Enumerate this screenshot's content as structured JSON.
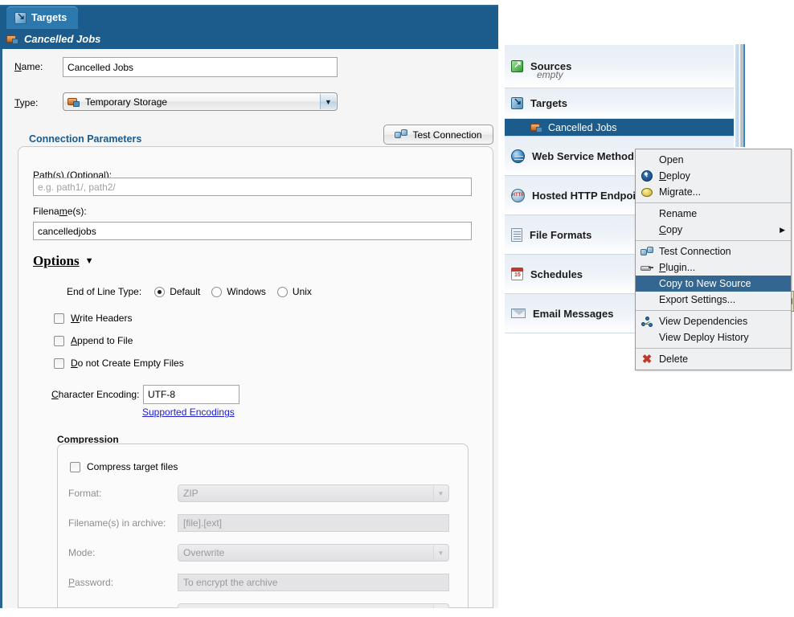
{
  "editor": {
    "tab": {
      "label": "Targets",
      "icon": "targets-icon"
    },
    "subtitle": {
      "label": "Cancelled Jobs",
      "icon": "temporary-storage-icon"
    },
    "name_field": {
      "label": "Name:",
      "value": "Cancelled Jobs"
    },
    "type_field": {
      "label": "Type:",
      "value": "Temporary Storage"
    },
    "connection_parameters": {
      "heading": "Connection Parameters",
      "test_connection_button": "Test Connection",
      "paths": {
        "label": "Path(s) (Optional):",
        "value": "",
        "placeholder": "e.g. path1/, path2/"
      },
      "filenames": {
        "label": "Filename(s):",
        "value": "cancelledjobs"
      }
    },
    "options": {
      "heading": "Options",
      "end_of_line": {
        "label": "End of Line Type:",
        "choices": [
          "Default",
          "Windows",
          "Unix"
        ],
        "selected": "Default"
      },
      "checkboxes": [
        {
          "label": "Write Headers",
          "checked": false
        },
        {
          "label": "Append to File",
          "checked": false
        },
        {
          "label": "Do not Create Empty Files",
          "checked": false
        }
      ],
      "character_encoding": {
        "label": "Character Encoding:",
        "value": "UTF-8"
      },
      "supported_encodings_link": "Supported Encodings"
    },
    "compression": {
      "heading": "Compression",
      "compress_checkbox": {
        "label": "Compress target files",
        "checked": false
      },
      "format": {
        "label": "Format:",
        "value": "ZIP"
      },
      "archive_filenames": {
        "label": "Filename(s) in archive:",
        "value": "[file].[ext]"
      },
      "mode": {
        "label": "Mode:",
        "value": "Overwrite"
      },
      "password": {
        "label": "Password:",
        "placeholder": "To encrypt the archive"
      }
    }
  },
  "tree": {
    "items": [
      {
        "label": "Sources",
        "icon": "sources-icon",
        "sub": "empty"
      },
      {
        "label": "Targets",
        "icon": "targets-icon",
        "child": {
          "label": "Cancelled Jobs",
          "icon": "temporary-storage-icon",
          "selected": true
        }
      },
      {
        "label": "Web Service Method",
        "icon": "web-service-icon"
      },
      {
        "label": "Hosted HTTP Endpoi",
        "icon": "http-endpoint-icon"
      },
      {
        "label": "File Formats",
        "icon": "file-formats-icon"
      },
      {
        "label": "Schedules",
        "icon": "schedules-icon"
      },
      {
        "label": "Email Messages",
        "icon": "email-icon"
      }
    ]
  },
  "context_menu": {
    "items": [
      {
        "label": "Open",
        "icon": null,
        "selected": false,
        "submenu": false,
        "separator_after": false
      },
      {
        "label": "Deploy",
        "icon": "deploy-icon",
        "selected": false,
        "submenu": false,
        "separator_after": false
      },
      {
        "label": "Migrate...",
        "icon": "migrate-icon",
        "selected": false,
        "submenu": false,
        "separator_after": true
      },
      {
        "label": "Rename",
        "icon": null,
        "selected": false,
        "submenu": false,
        "separator_after": false
      },
      {
        "label": "Copy",
        "icon": null,
        "selected": false,
        "submenu": true,
        "separator_after": true
      },
      {
        "label": "Test Connection",
        "icon": "test-connection-icon",
        "selected": false,
        "submenu": false,
        "separator_after": false
      },
      {
        "label": "Plugin...",
        "icon": "plugin-icon",
        "selected": false,
        "submenu": false,
        "separator_after": false
      },
      {
        "label": "Copy to New Source",
        "icon": null,
        "selected": true,
        "submenu": false,
        "separator_after": false
      },
      {
        "label": "Export Settings...",
        "icon": null,
        "selected": false,
        "submenu": false,
        "separator_after": true
      },
      {
        "label": "View Dependencies",
        "icon": "view-dependencies-icon",
        "selected": false,
        "submenu": false,
        "separator_after": false
      },
      {
        "label": "View Deploy History",
        "icon": null,
        "selected": false,
        "submenu": false,
        "separator_after": true
      },
      {
        "label": "Delete",
        "icon": "delete-icon",
        "selected": false,
        "submenu": false,
        "separator_after": false
      }
    ],
    "submenu_arrow": "▶"
  },
  "colors": {
    "header_blue": "#1c5c8c",
    "tab_blue": "#2d79ad",
    "selection_blue": "#336791",
    "link_blue": "#2020d0",
    "heading_blue": "#1a5b8e"
  }
}
